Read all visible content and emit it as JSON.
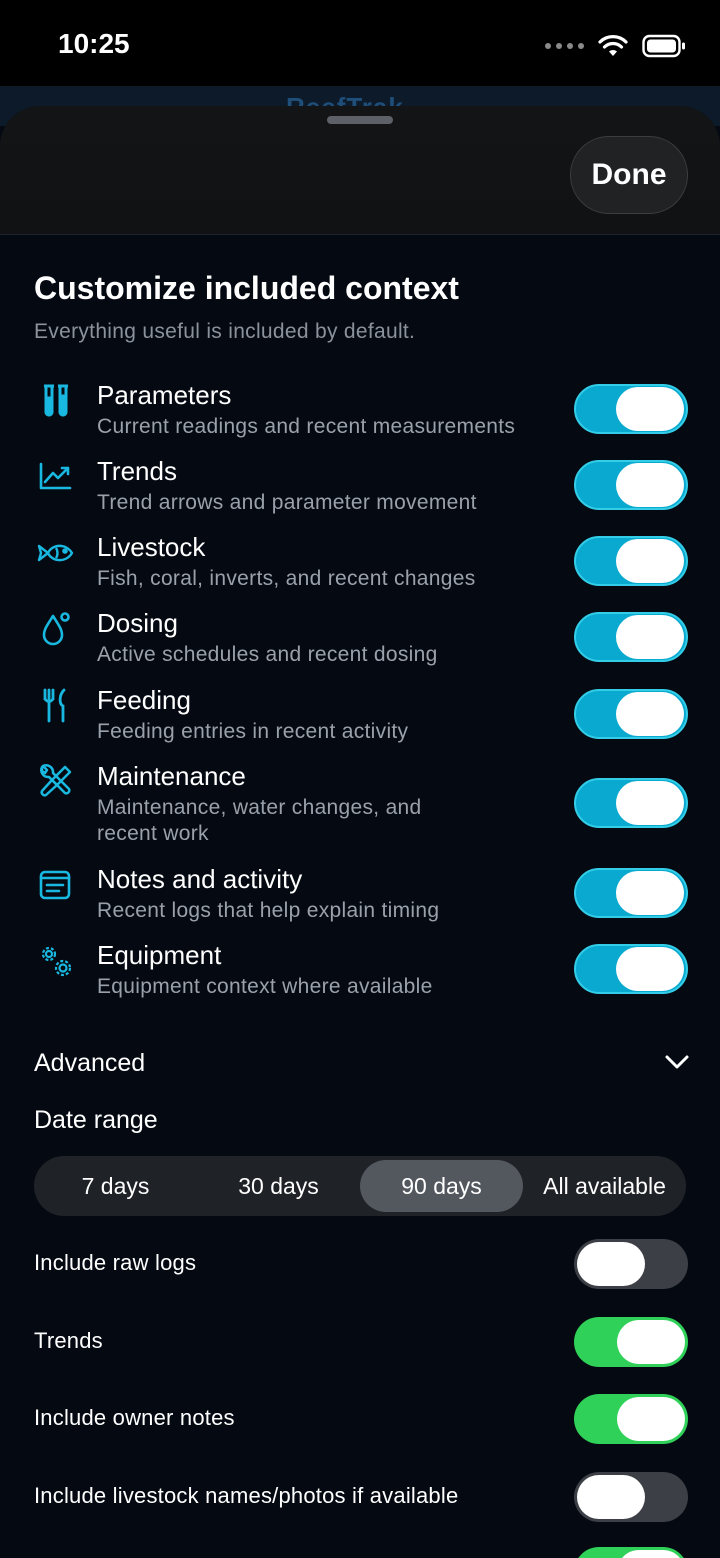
{
  "status_bar": {
    "time": "10:25"
  },
  "backdrop": {
    "partial_title": "ReefTrak"
  },
  "header": {
    "done_label": "Done"
  },
  "page": {
    "title": "Customize included context",
    "subtitle": "Everything useful is included by default."
  },
  "context_items": [
    {
      "icon": "test-tubes-icon",
      "title": "Parameters",
      "description": "Current readings and recent measurements",
      "enabled": true
    },
    {
      "icon": "trend-chart-icon",
      "title": "Trends",
      "description": "Trend arrows and parameter movement",
      "enabled": true
    },
    {
      "icon": "fish-icon",
      "title": "Livestock",
      "description": "Fish, coral, inverts, and recent changes",
      "enabled": true
    },
    {
      "icon": "drop-icon",
      "title": "Dosing",
      "description": "Active schedules and recent dosing",
      "enabled": true
    },
    {
      "icon": "fork-knife-icon",
      "title": "Feeding",
      "description": "Feeding entries in recent activity",
      "enabled": true
    },
    {
      "icon": "wrench-screwdriver-icon",
      "title": "Maintenance",
      "description": "Maintenance, water changes, and recent work",
      "enabled": true
    },
    {
      "icon": "notes-icon",
      "title": "Notes and activity",
      "description": "Recent logs that help explain timing",
      "enabled": true
    },
    {
      "icon": "gears-icon",
      "title": "Equipment",
      "description": "Equipment context where available",
      "enabled": true
    }
  ],
  "advanced": {
    "label": "Advanced",
    "date_range_label": "Date range",
    "date_range_options": [
      "7 days",
      "30 days",
      "90 days",
      "All available"
    ],
    "selected_date_range": "90 days",
    "options": [
      {
        "label": "Include raw logs",
        "enabled": false
      },
      {
        "label": "Trends",
        "enabled": true
      },
      {
        "label": "Include owner notes",
        "enabled": true
      },
      {
        "label": "Include livestock names/photos if available",
        "enabled": false
      }
    ]
  },
  "colors": {
    "accent_blue": "#0aa9cf",
    "accent_green": "#2fd158",
    "background": "#050a12"
  }
}
